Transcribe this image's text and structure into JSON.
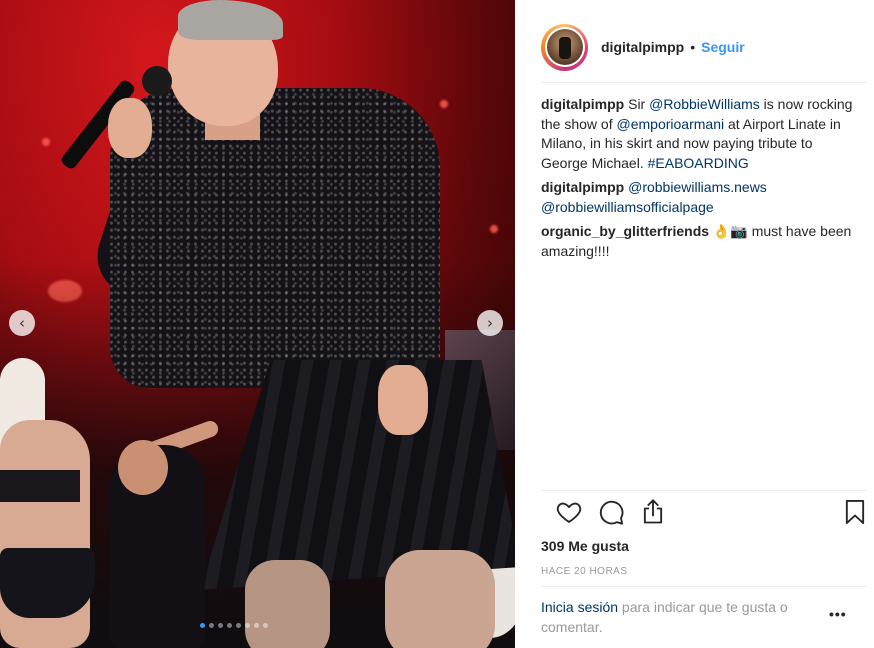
{
  "post": {
    "username": "digitalpimpp",
    "separator": "•",
    "follow_label": "Seguir"
  },
  "caption": {
    "user": "digitalpimpp",
    "segments": {
      "t1": "Sir ",
      "m1": "@RobbieWilliams",
      "t2": " is now rocking the show of ",
      "m2": "@emporioarmani",
      "t3": " at Airport Linate in Milano, in his skirt and now paying tribute to George Michael. ",
      "h1": "#EABOARDING"
    }
  },
  "comments": [
    {
      "user": "digitalpimpp",
      "m1": "@robbiewilliams.news",
      "m2": "@robbiewilliamsofficialpage"
    },
    {
      "user": "organic_by_glitterfriends",
      "text": " 👌📷 must have been amazing!!!!"
    }
  ],
  "actions": {
    "like_icon": "heart-icon",
    "comment_icon": "comment-icon",
    "share_icon": "share-icon",
    "save_icon": "bookmark-icon"
  },
  "likes_label": "309 Me gusta",
  "time_label": "HACE 20 HORAS",
  "login_prompt": {
    "link": "Inicia sesión",
    "text": " para indicar que te gusta o comentar."
  },
  "more_label": "•••",
  "carousel": {
    "prev_label": "‹",
    "next_label": "›",
    "dot_count": 8,
    "active_index": 0
  },
  "colors": {
    "link_blue": "#3897f0",
    "mention": "#003569",
    "text": "#262626",
    "muted": "#999999"
  }
}
